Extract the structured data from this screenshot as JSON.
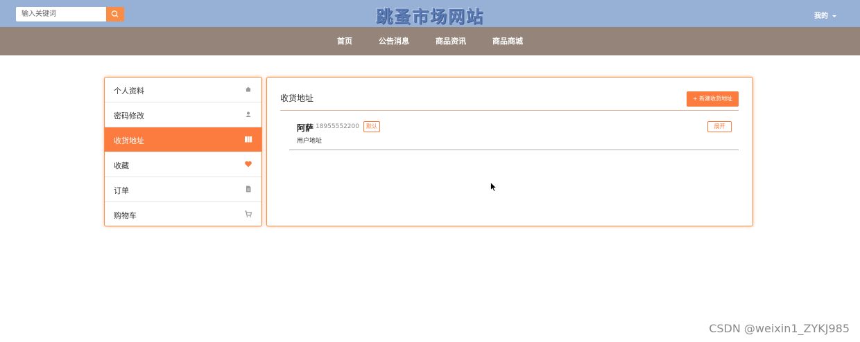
{
  "header": {
    "search": {
      "placeholder": "输入关键词",
      "value": ""
    },
    "site_title": "跳蚤市场网站",
    "user_menu": "我的"
  },
  "nav": {
    "items": [
      {
        "label": "首页"
      },
      {
        "label": "公告消息"
      },
      {
        "label": "商品资讯"
      },
      {
        "label": "商品商城"
      }
    ]
  },
  "sidebar": {
    "items": [
      {
        "label": "个人资料",
        "icon": "home-icon",
        "active": false
      },
      {
        "label": "密码修改",
        "icon": "user-icon",
        "active": false
      },
      {
        "label": "收货地址",
        "icon": "map-icon",
        "active": true
      },
      {
        "label": "收藏",
        "icon": "heart-icon",
        "active": false
      },
      {
        "label": "订单",
        "icon": "file-icon",
        "active": false
      },
      {
        "label": "购物车",
        "icon": "cart-icon",
        "active": false
      }
    ]
  },
  "main": {
    "title": "收货地址",
    "new_button": "+ 新建收货地址",
    "addresses": [
      {
        "name": "阿萨",
        "phone": "18955552200",
        "badge": "默认",
        "detail": "用户地址",
        "expand_label": "展开"
      }
    ]
  },
  "watermark": "CSDN @weixin1_ZYKJ985",
  "colors": {
    "topbar": "#97b0d6",
    "navbar": "#958479",
    "accent": "#fb7c3e"
  }
}
